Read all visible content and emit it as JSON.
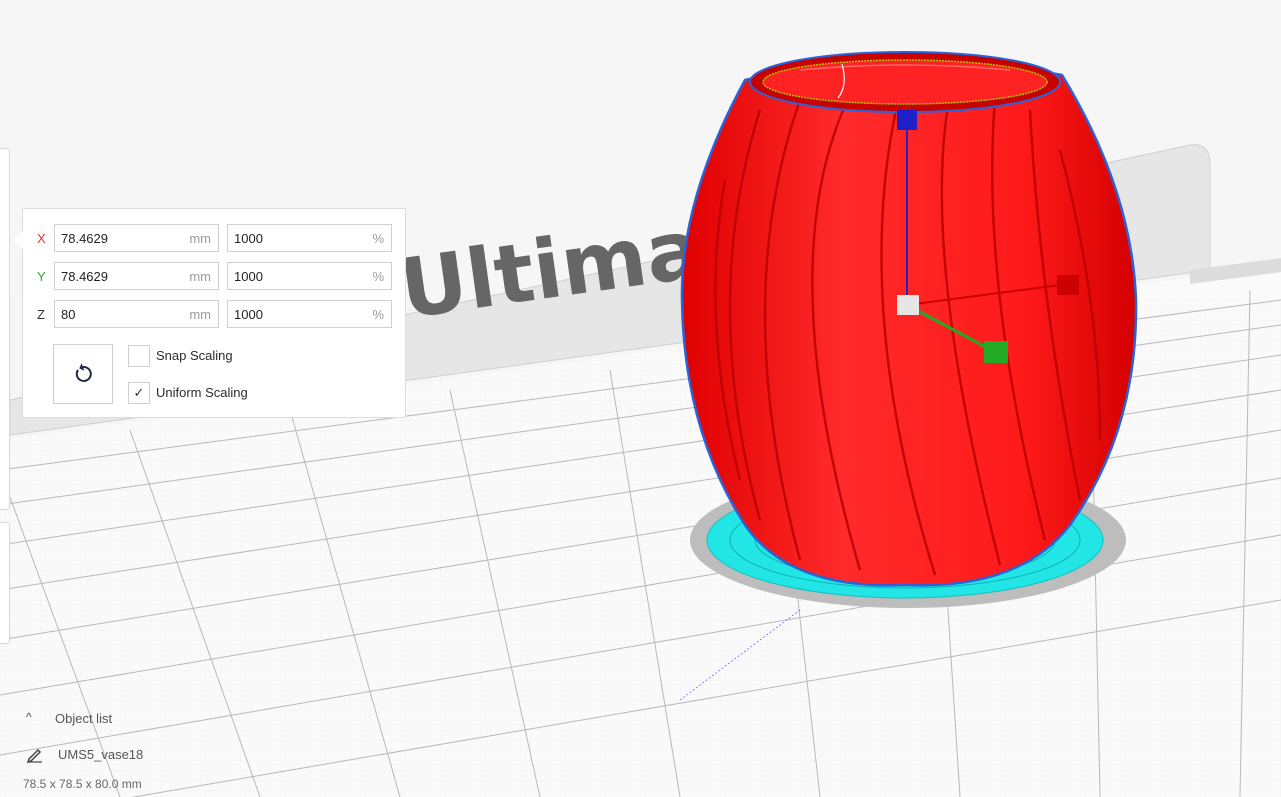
{
  "scale_panel": {
    "rows": [
      {
        "axis": "X",
        "axis_color": "#d33a2c",
        "mm_value": "78.4629",
        "mm_unit": "mm",
        "pct_value": "1000",
        "pct_unit": "%"
      },
      {
        "axis": "Y",
        "axis_color": "#3aa63a",
        "mm_value": "78.4629",
        "mm_unit": "mm",
        "pct_value": "1000",
        "pct_unit": "%"
      },
      {
        "axis": "Z",
        "axis_color": "#333333",
        "mm_value": "80",
        "mm_unit": "mm",
        "pct_value": "1000",
        "pct_unit": "%"
      }
    ],
    "reset_icon": "reset-rotate-icon",
    "snap_scaling": {
      "label": "Snap Scaling",
      "checked": false
    },
    "uniform_scaling": {
      "label": "Uniform Scaling",
      "checked": true,
      "check_mark": "✓"
    }
  },
  "object_list": {
    "header": "Object list",
    "chevron": "^",
    "item": "UMS5_vase18",
    "dimensions": "78.5 x 78.5 x 80.0 mm"
  },
  "scene": {
    "backplate_text": "Ultima",
    "model_color": "#ff1a1a",
    "brim_color": "#22e6e6",
    "gizmo_colors": {
      "z": "#2020c8",
      "x": "#cc0000",
      "y": "#22aa22"
    }
  }
}
